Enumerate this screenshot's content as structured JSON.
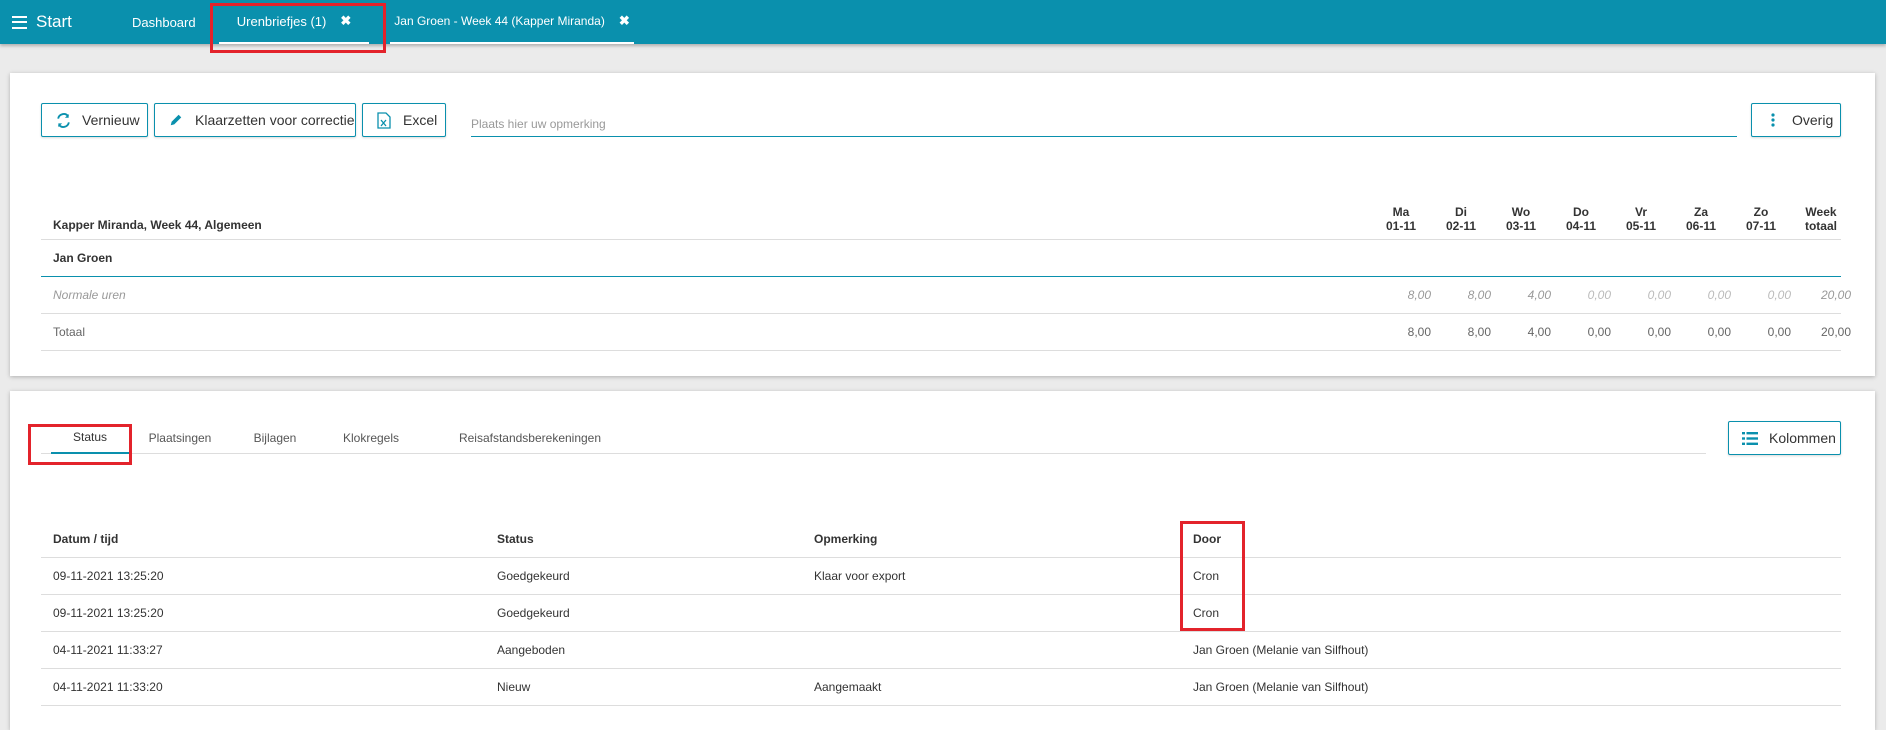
{
  "topbar": {
    "menu_label": "Start",
    "tabs": [
      {
        "label": "Dashboard"
      },
      {
        "label": "Urenbriefjes (1)"
      },
      {
        "label": "Jan Groen - Week 44 (Kapper Miranda)"
      }
    ]
  },
  "toolbar": {
    "refresh_label": "Vernieuw",
    "correction_label": "Klaarzetten voor correctie",
    "excel_label": "Excel",
    "remark_placeholder": "Plaats hier uw opmerking",
    "other_label": "Overig"
  },
  "hours_table": {
    "title": "Kapper Miranda, Week 44, Algemeen",
    "days": [
      {
        "name": "Ma",
        "date": "01-11"
      },
      {
        "name": "Di",
        "date": "02-11"
      },
      {
        "name": "Wo",
        "date": "03-11"
      },
      {
        "name": "Do",
        "date": "04-11"
      },
      {
        "name": "Vr",
        "date": "05-11"
      },
      {
        "name": "Za",
        "date": "06-11"
      },
      {
        "name": "Zo",
        "date": "07-11"
      }
    ],
    "week_total_header": [
      "Week",
      "totaal"
    ],
    "employee": "Jan Groen",
    "rows": [
      {
        "label": "Normale uren",
        "values": [
          "8,00",
          "8,00",
          "4,00",
          "0,00",
          "0,00",
          "0,00",
          "0,00"
        ],
        "total": "20,00"
      },
      {
        "label": "Totaal",
        "values": [
          "8,00",
          "8,00",
          "4,00",
          "0,00",
          "0,00",
          "0,00",
          "0,00"
        ],
        "total": "20,00"
      }
    ]
  },
  "tabs": [
    {
      "label": "Status"
    },
    {
      "label": "Plaatsingen"
    },
    {
      "label": "Bijlagen"
    },
    {
      "label": "Klokregels"
    },
    {
      "label": "Reisafstandsberekeningen"
    }
  ],
  "columns_label": "Kolommen",
  "status_table": {
    "headers": [
      "Datum / tijd",
      "Status",
      "Opmerking",
      "Door"
    ],
    "rows": [
      [
        "09-11-2021 13:25:20",
        "Goedgekeurd",
        "Klaar voor export",
        "Cron"
      ],
      [
        "09-11-2021 13:25:20",
        "Goedgekeurd",
        "",
        "Cron"
      ],
      [
        "04-11-2021 11:33:27",
        "Aangeboden",
        "",
        "Jan Groen (Melanie van Silfhout)"
      ],
      [
        "04-11-2021 11:33:20",
        "Nieuw",
        "Aangemaakt",
        "Jan Groen (Melanie van Silfhout)"
      ]
    ]
  },
  "colors": {
    "brand": "#0a90ad",
    "highlight": "#e3232b"
  }
}
